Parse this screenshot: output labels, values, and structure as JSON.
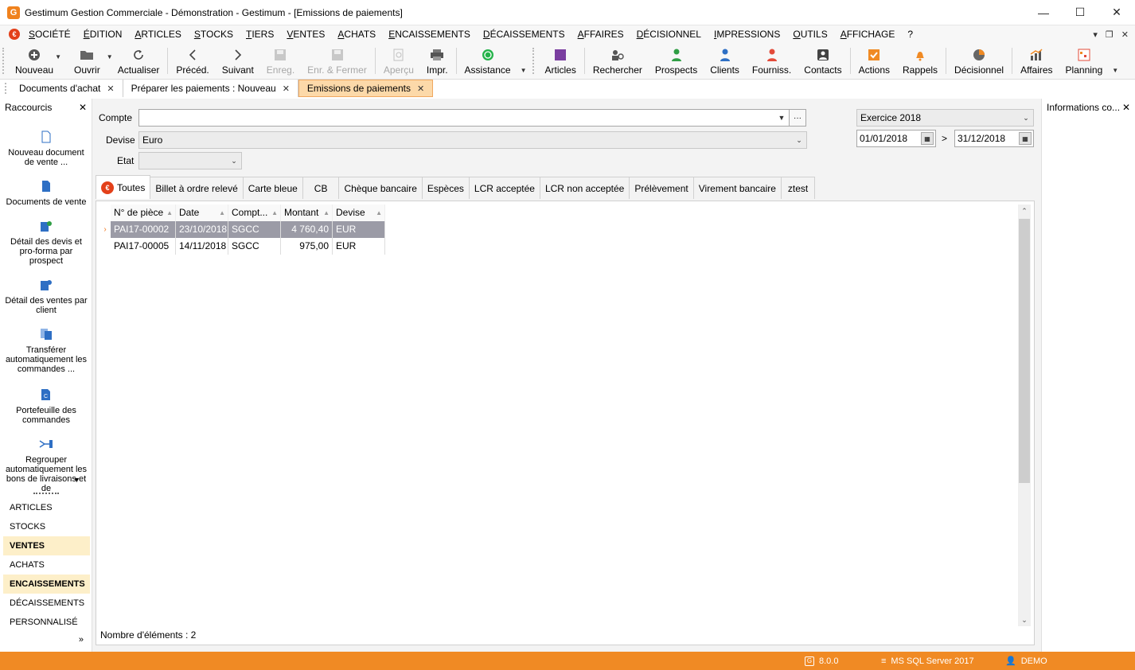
{
  "window": {
    "title": "Gestimum Gestion Commerciale - Démonstration - Gestimum - [Emissions de paiements]",
    "logo_letter": "G",
    "controls": [
      "—",
      "☐",
      "✕"
    ]
  },
  "menu": {
    "items": [
      "SOCIÉTÉ",
      "ÉDITION",
      "ARTICLES",
      "STOCKS",
      "TIERS",
      "VENTES",
      "ACHATS",
      "ENCAISSEMENTS",
      "DÉCAISSEMENTS",
      "AFFAIRES",
      "DÉCISIONNEL",
      "IMPRESSIONS",
      "OUTILS",
      "AFFICHAGE",
      "?"
    ],
    "right": [
      "▾",
      "❐",
      "✕"
    ]
  },
  "toolbar": {
    "nouveau": "Nouveau",
    "ouvrir": "Ouvrir",
    "actualiser": "Actualiser",
    "preced": "Précéd.",
    "suivant": "Suivant",
    "enreg": "Enreg.",
    "enr_fermer": "Enr. & Fermer",
    "apercu": "Aperçu",
    "impr": "Impr.",
    "assistance": "Assistance",
    "articles": "Articles",
    "rechercher": "Rechercher",
    "prospects": "Prospects",
    "clients": "Clients",
    "fourniss": "Fourniss.",
    "contacts": "Contacts",
    "actions": "Actions",
    "rappels": "Rappels",
    "decisionnel": "Décisionnel",
    "affaires": "Affaires",
    "planning": "Planning"
  },
  "doc_tabs": [
    {
      "label": "Documents d'achat"
    },
    {
      "label": "Préparer les paiements : Nouveau"
    },
    {
      "label": "Emissions de paiements"
    }
  ],
  "sidebar": {
    "title": "Raccourcis",
    "shortcuts": [
      "Nouveau document de vente ...",
      "Documents de vente",
      "Détail des devis et pro-forma par prospect",
      "Détail des ventes par client",
      "Transférer automatiquement les commandes ...",
      "Portefeuille des commandes",
      "Regrouper automatiquement les bons de livraisons et de"
    ],
    "categories": [
      "ARTICLES",
      "STOCKS",
      "VENTES",
      "ACHATS",
      "ENCAISSEMENTS",
      "DÉCAISSEMENTS",
      "PERSONNALISÉ"
    ],
    "more": "»"
  },
  "form": {
    "compte_label": "Compte",
    "compte_value": "",
    "devise_label": "Devise",
    "devise_value": "Euro",
    "etat_label": "Etat",
    "etat_value": "",
    "exercice_value": "Exercice 2018",
    "date_from": "01/01/2018",
    "date_sep": ">",
    "date_to": "31/12/2018",
    "ellipsis": "···"
  },
  "payment_tabs": [
    "Toutes",
    "Billet à ordre relevé",
    "Carte bleue",
    "CB",
    "Chèque bancaire",
    "Espèces",
    "LCR acceptée",
    "LCR non acceptée",
    "Prélèvement",
    "Virement bancaire",
    "ztest"
  ],
  "grid": {
    "columns": [
      "N° de pièce",
      "Date",
      "Compt...",
      "Montant",
      "Devise"
    ],
    "rows": [
      {
        "piece": "PAI17-00002",
        "date": "23/10/2018",
        "compte": "SGCC",
        "montant": "4 760,40",
        "devise": "EUR"
      },
      {
        "piece": "PAI17-00005",
        "date": "14/11/2018",
        "compte": "SGCC",
        "montant": "975,00",
        "devise": "EUR"
      }
    ],
    "count_label": "Nombre d'éléments : 2"
  },
  "right_panel": {
    "title": "Informations co..."
  },
  "status": {
    "version": "8.0.0",
    "db": "MS SQL Server 2017",
    "user": "DEMO"
  }
}
